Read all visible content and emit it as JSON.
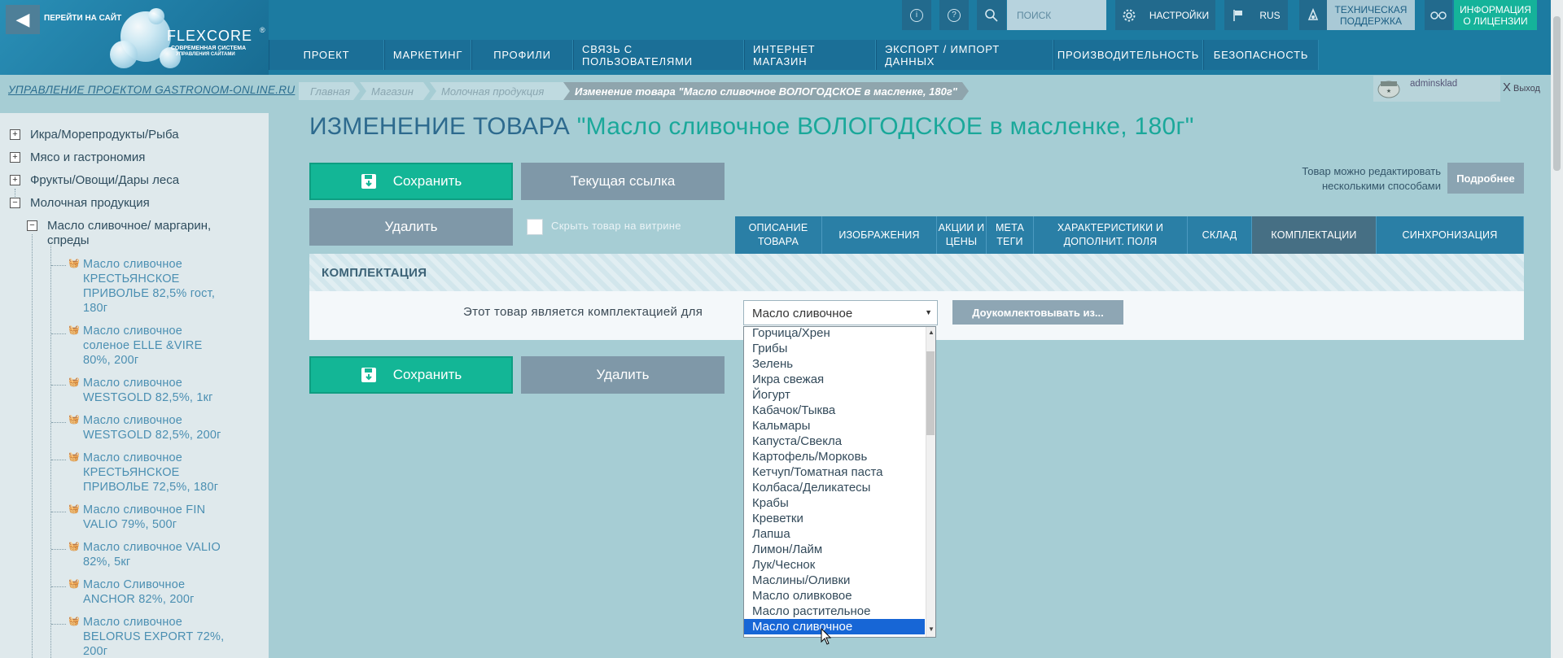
{
  "header": {
    "go_site": "ПЕРЕЙТИ НА САЙТ",
    "brand": "FLEXCORE",
    "brand_reg": "®",
    "brand_sub1": "СОВРЕМЕННАЯ СИСТЕМА",
    "brand_sub2": "УПРАВЛЕНИЯ САЙТАМИ",
    "search_placeholder": "ПОИСК",
    "settings": "НАСТРОЙКИ",
    "lang": "RUS",
    "support_line1": "ТЕХНИЧЕСКАЯ",
    "support_line2": "ПОДДЕРЖКА",
    "license_line1": "ИНФОРМАЦИЯ",
    "license_line2": "О ЛИЦЕНЗИИ",
    "info_icon": "i",
    "help_icon": "?"
  },
  "nav": [
    "ПРОЕКТ",
    "МАРКЕТИНГ",
    "ПРОФИЛИ",
    "СВЯЗЬ С ПОЛЬЗОВАТЕЛЯМИ",
    "ИНТЕРНЕТ МАГАЗИН",
    "ЭКСПОРТ / ИМПОРТ ДАННЫХ",
    "ПРОИЗВОДИТЕЛЬНОСТЬ",
    "БЕЗОПАСНОСТЬ"
  ],
  "project_title": "УПРАВЛЕНИЕ ПРОЕКТОМ GASTRONOM-ONLINE.RU",
  "breadcrumb": [
    "Главная",
    "Магазин",
    "Молочная продукция",
    "Изменение товара \"Масло сливочное ВОЛОГОДСКОЕ в масленке, 180г\""
  ],
  "user": {
    "name": "adminsklad",
    "logout": "Выход",
    "logout_mark": "X"
  },
  "sidebar": {
    "top_items": [
      {
        "label": "Икра/Морепродукты/Рыба",
        "mark": "+"
      },
      {
        "label": "Мясо и гастрономия",
        "mark": "+"
      },
      {
        "label": "Фрукты/Овощи/Дары леса",
        "mark": "+"
      },
      {
        "label": "Молочная продукция",
        "mark": "−"
      }
    ],
    "sub_item": {
      "mark": "−",
      "line1": "Масло сливочное/ маргарин,",
      "line2": "спреды"
    },
    "leaves": [
      "Масло сливочное КРЕСТЬЯНСКОЕ ПРИВОЛЬЕ 82,5% гост, 180г",
      "Масло сливочное соленое ELLE &VIRE 80%, 200г",
      "Масло сливочное WESTGOLD 82,5%, 1кг",
      "Масло сливочное WESTGOLD 82,5%, 200г",
      "Масло сливочное КРЕСТЬЯНСКОЕ ПРИВОЛЬЕ 72,5%, 180г",
      "Масло сливочное FIN VALIO 79%, 500г",
      "Масло сливочное VALIO 82%, 5кг",
      "Масло Сливочное ANCHOR 82%, 200г",
      "Масло сливочное BELORUS EXPORT 72%, 200г"
    ]
  },
  "page": {
    "title_prefix": "ИЗМЕНЕНИЕ ТОВАРА",
    "title_product": "\"Масло сливочное ВОЛОГОДСКОЕ в масленке, 180г\"",
    "save": "Сохранить",
    "current_link": "Текущая ссылка",
    "delete": "Удалить",
    "hide_label": "Скрыть товар на витрине",
    "multi_note_line1": "Товар можно редактировать",
    "multi_note_line2": "несколькими способами",
    "more": "Подробнее"
  },
  "tabs": [
    {
      "line1": "ОПИСАНИЕ",
      "line2": "ТОВАРА",
      "active": false
    },
    {
      "line1": "ИЗОБРАЖЕНИЯ",
      "line2": "",
      "active": false
    },
    {
      "line1": "АКЦИИ И",
      "line2": "ЦЕНЫ",
      "active": false
    },
    {
      "line1": "МЕТА",
      "line2": "ТЕГИ",
      "active": false
    },
    {
      "line1": "ХАРАКТЕРИСТИКИ И",
      "line2": "ДОПОЛНИТ. ПОЛЯ",
      "active": false
    },
    {
      "line1": "СКЛАД",
      "line2": "",
      "active": false
    },
    {
      "line1": "КОМПЛЕКТАЦИИ",
      "line2": "",
      "active": true
    },
    {
      "line1": "СИНХРОНИЗАЦИЯ",
      "line2": "",
      "active": false
    }
  ],
  "panel": {
    "heading": "КОМПЛЕКТАЦИЯ",
    "kit_label": "Этот товар является комплектацией для",
    "kit_selected": "Масло сливочное",
    "complete_from": "Доукомлектовывать из..."
  },
  "dropdown_options": [
    "Горчица/Хрен",
    "Грибы",
    "Зелень",
    "Икра свежая",
    "Йогурт",
    "Кабачок/Тыква",
    "Кальмары",
    "Капуста/Свекла",
    "Картофель/Морковь",
    "Кетчуп/Томатная паста",
    "Колбаса/Деликатесы",
    "Крабы",
    "Креветки",
    "Лапша",
    "Лимон/Лайм",
    "Лук/Чеснок",
    "Маслины/Оливки",
    "Масло оливковое",
    "Масло растительное",
    "Масло сливочное"
  ],
  "dropdown_selected_index": 19,
  "colors": {
    "header_bg": "#1c7ba1",
    "accent_green": "#13b696",
    "gray_button": "#7f98a8",
    "page_bg": "#a6cdd4",
    "selected_option": "#1766d6"
  }
}
